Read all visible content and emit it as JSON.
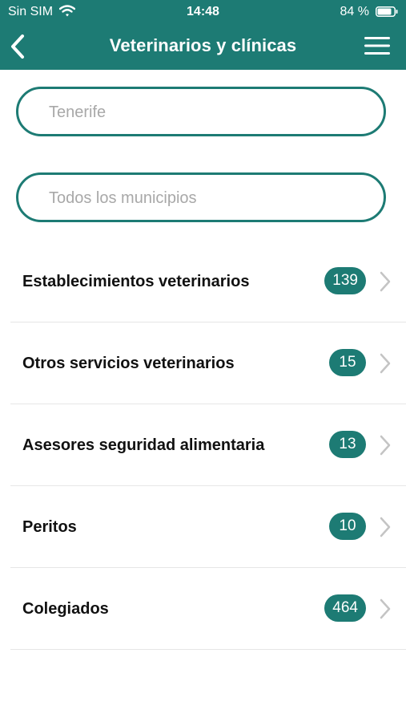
{
  "status_bar": {
    "carrier": "Sin SIM",
    "time": "14:48",
    "battery_percent": "84 %"
  },
  "header": {
    "title": "Veterinarios y clínicas",
    "back_icon": "chevron-left-icon",
    "menu_icon": "hamburger-menu-icon"
  },
  "filters": {
    "island": {
      "placeholder": "Tenerife",
      "value": ""
    },
    "municipality": {
      "placeholder": "Todos los municipios",
      "value": ""
    }
  },
  "categories": [
    {
      "label": "Establecimientos veterinarios",
      "count": "139"
    },
    {
      "label": "Otros servicios veterinarios",
      "count": "15"
    },
    {
      "label": "Asesores seguridad alimentaria",
      "count": "13"
    },
    {
      "label": "Peritos",
      "count": "10"
    },
    {
      "label": "Colegiados",
      "count": "464"
    }
  ],
  "colors": {
    "brand": "#1d7b74",
    "chevron": "#c4c4c4"
  }
}
